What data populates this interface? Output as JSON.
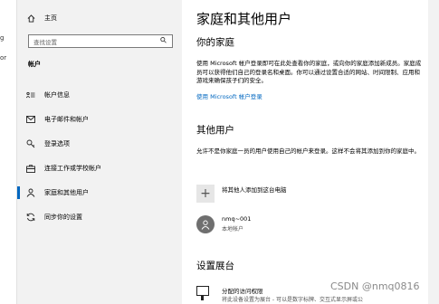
{
  "left_edge": {
    "line1": "g",
    "line2": "or"
  },
  "sidebar": {
    "home_label": "主页",
    "search_placeholder": "查找设置",
    "section_label": "帐户",
    "items": [
      {
        "label": "帐户信息",
        "icon": "account-info-icon"
      },
      {
        "label": "电子邮件和帐户",
        "icon": "mail-icon"
      },
      {
        "label": "登录选项",
        "icon": "key-icon"
      },
      {
        "label": "连接工作或学校帐户",
        "icon": "briefcase-icon"
      },
      {
        "label": "家庭和其他用户",
        "icon": "person-icon",
        "active": true
      },
      {
        "label": "同步你的设置",
        "icon": "sync-icon"
      }
    ]
  },
  "main": {
    "title": "家庭和其他用户",
    "family": {
      "heading": "你的家庭",
      "description": "使用 Microsoft 帐户登录即可在此处查看你的家庭，或向你的家庭添加新成员。家庭成员可以获得他们自己的登录名和桌面。你可以通过设置合适的网站、时间限制、应用和游戏来确保孩子们的安全。",
      "link": "使用 Microsoft 帐户登录"
    },
    "others": {
      "heading": "其他用户",
      "description": "允许不是你家庭一员的用户使用自己的帐户来登录。这样不会将其添加到你的家庭中。",
      "add_label": "将其他人添加到这台电脑",
      "user_name": "nmq~001",
      "user_type": "本地帐户"
    },
    "kiosk": {
      "heading": "设置展台",
      "title": "分配的访问权限",
      "description": "将此设备设置为展台 - 可以是数字标牌、交互式显示屏或公"
    }
  },
  "watermark": "CSDN @nmq0816",
  "colors": {
    "accent": "#0067c0",
    "sidebar_bg": "#f2f2f2",
    "avatar": "#6f6f6f"
  }
}
